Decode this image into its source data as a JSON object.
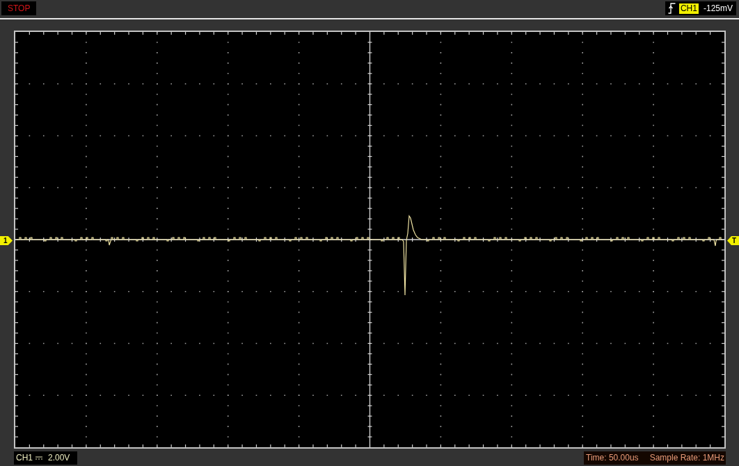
{
  "run_status": {
    "label": "STOP"
  },
  "trigger": {
    "source": "CH1",
    "level": "-125mV"
  },
  "markers": [
    {
      "kind": "channel",
      "label": "1"
    },
    {
      "kind": "trigger",
      "label": "T"
    }
  ],
  "channel_info": {
    "channel": "CH1",
    "scale": "2.00V"
  },
  "timebase": {
    "time": "Time: 50.00us",
    "sample_rate": "Sample Rate: 1MHz"
  }
}
